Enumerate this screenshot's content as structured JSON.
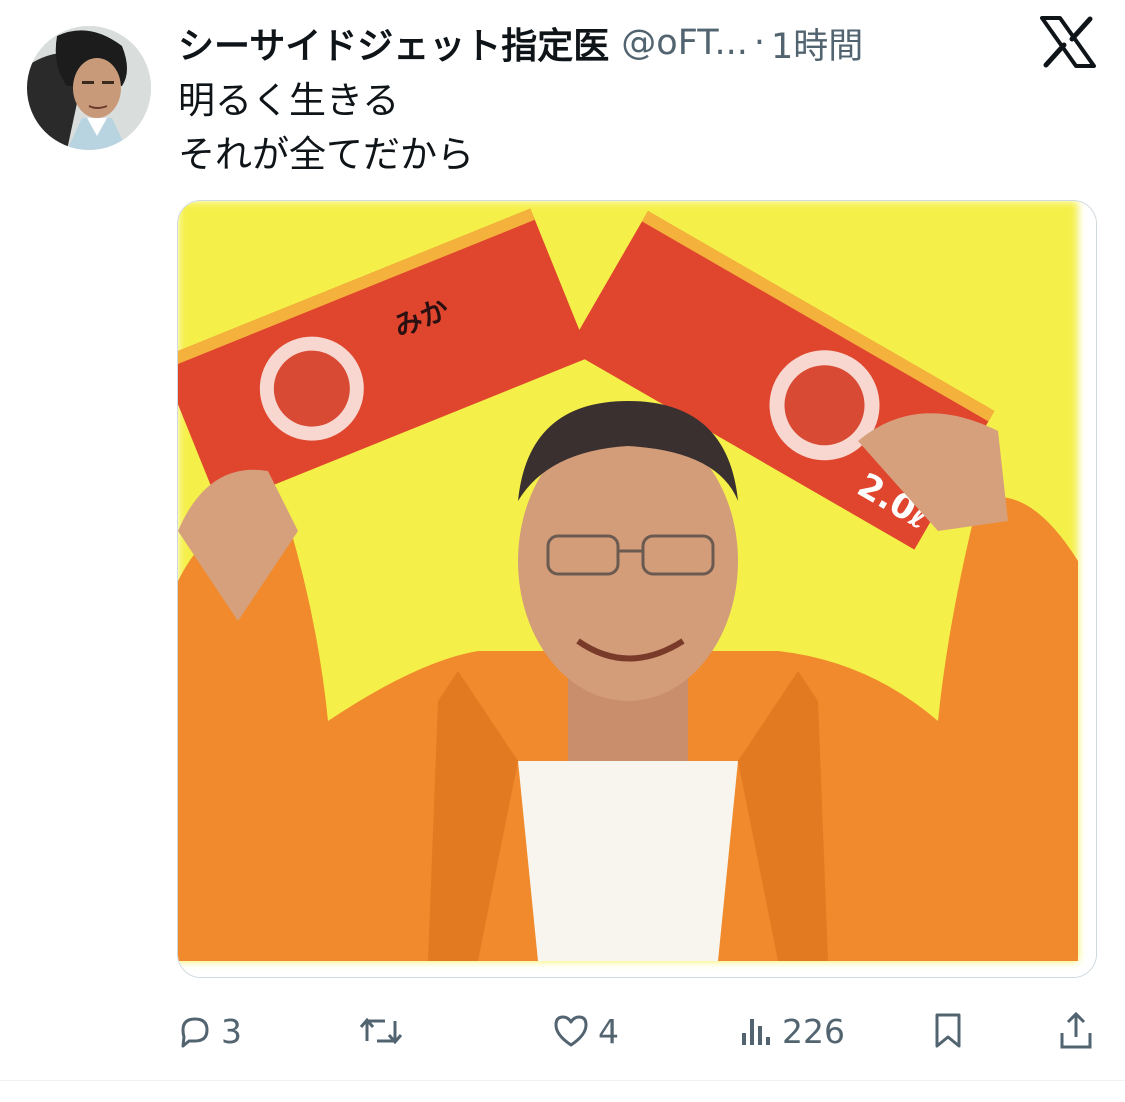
{
  "tweet": {
    "display_name": "シーサイドジェット指定医",
    "handle": "@oFT...",
    "separator": "·",
    "time": "1時間",
    "text_lines": [
      "明るく生きる",
      "それが全てだから"
    ]
  },
  "media": {
    "icon": "photo",
    "box_label": "2.0ℓ"
  },
  "actions": {
    "reply_count": "3",
    "repost_count": "",
    "like_count": "4",
    "views_count": "226"
  },
  "icons": [
    "x-logo-icon",
    "reply-icon",
    "repost-icon",
    "like-icon",
    "views-icon",
    "bookmark-icon",
    "share-icon"
  ],
  "colors": {
    "text": "#0f1419",
    "secondary": "#536471",
    "media_background": "#f5f04a",
    "jacket": "#f08a2c",
    "box_red": "#e0452e"
  }
}
